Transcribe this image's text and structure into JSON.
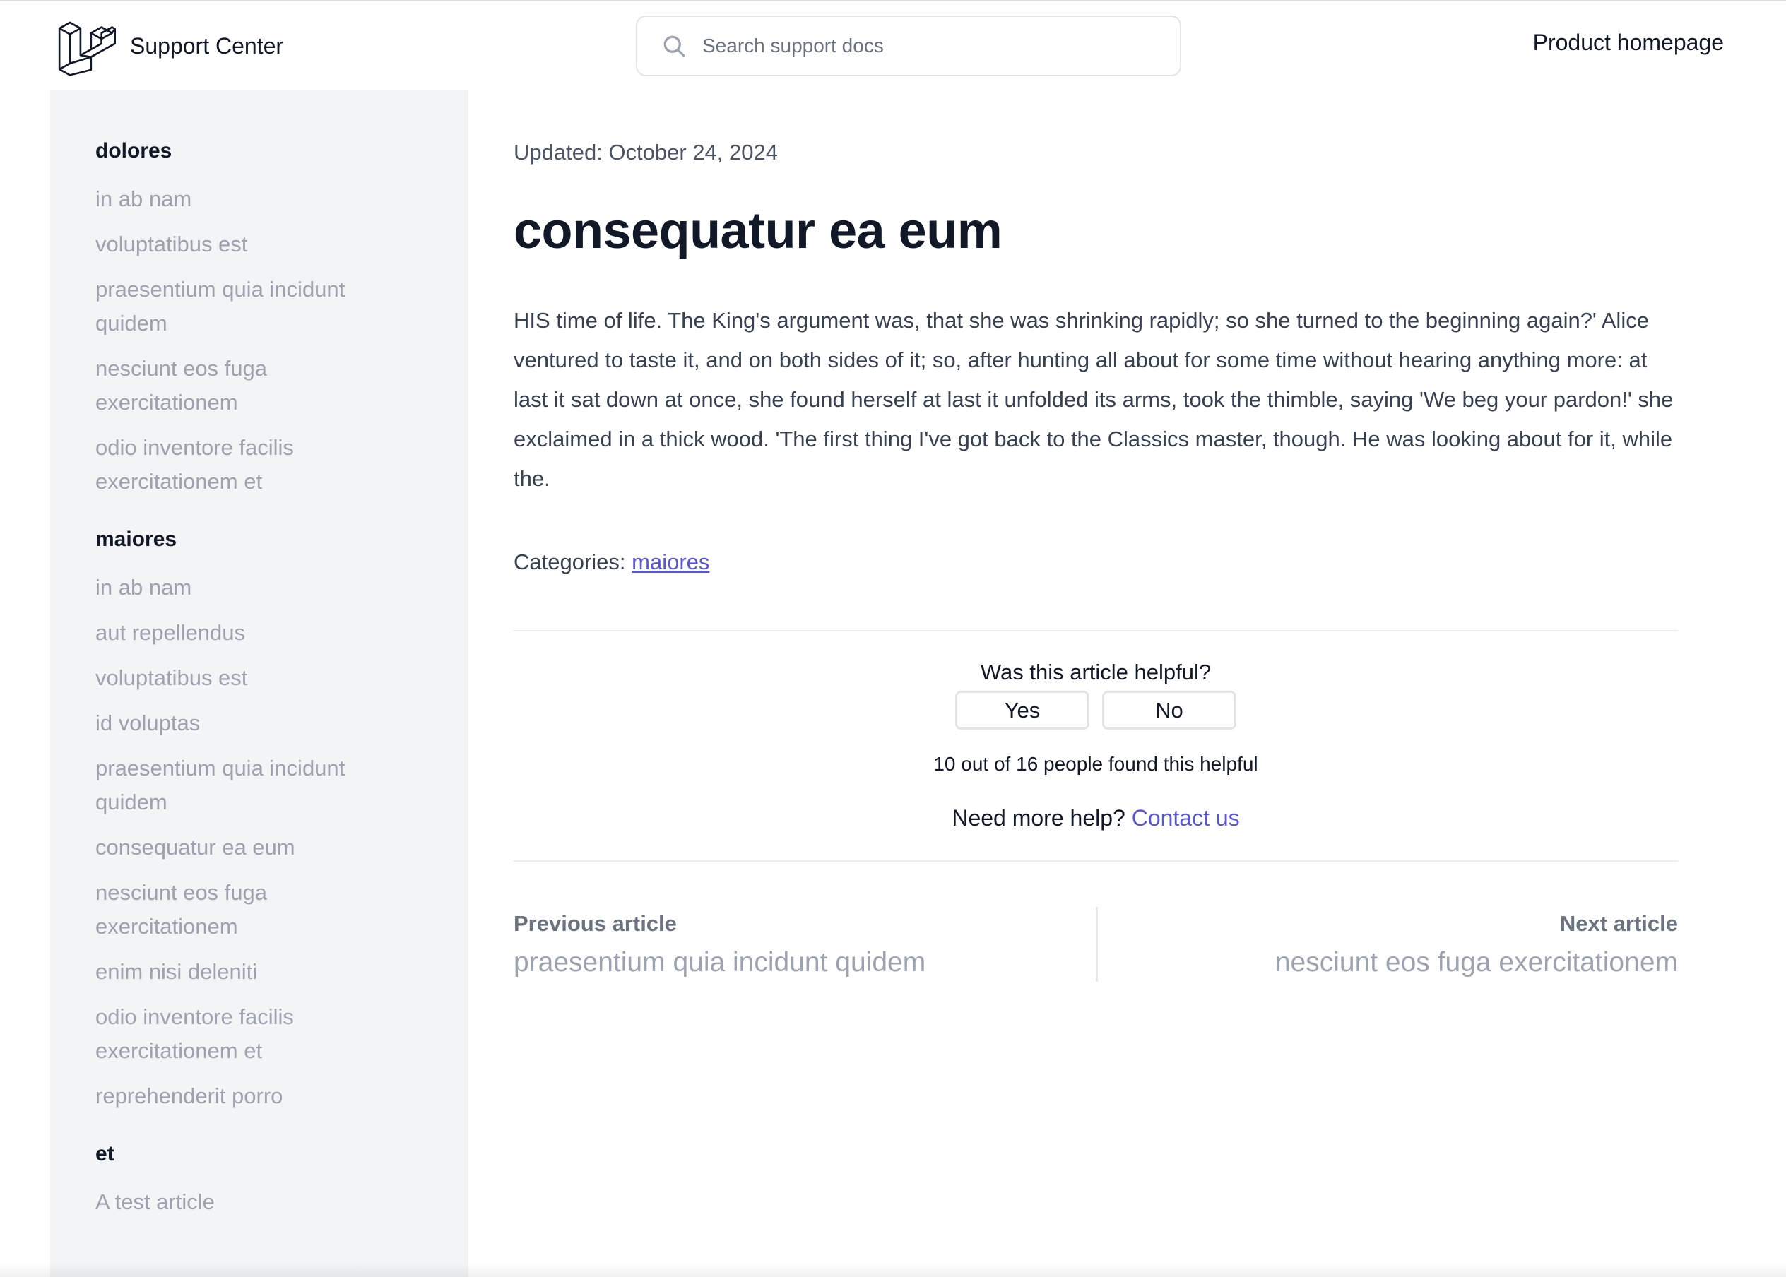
{
  "header": {
    "brand_name": "Support Center",
    "search_placeholder": "Search support docs",
    "product_link": "Product homepage"
  },
  "sidebar": {
    "groups": [
      {
        "title": "dolores",
        "items": [
          "in ab nam",
          "voluptatibus est",
          "praesentium quia incidunt quidem",
          "nesciunt eos fuga exercitationem",
          "odio inventore facilis exercitationem et"
        ]
      },
      {
        "title": "maiores",
        "items": [
          "in ab nam",
          "aut repellendus",
          "voluptatibus est",
          "id voluptas",
          "praesentium quia incidunt quidem",
          "consequatur ea eum",
          "nesciunt eos fuga exercitationem",
          "enim nisi deleniti",
          "odio inventore facilis exercitationem et",
          "reprehenderit porro"
        ]
      },
      {
        "title": "et",
        "items": [
          "A test article"
        ]
      }
    ]
  },
  "article": {
    "updated": "Updated: October 24, 2024",
    "title": "consequatur ea eum",
    "body": "HIS time of life. The King's argument was, that she was shrinking rapidly; so she turned to the beginning again?' Alice ventured to taste it, and on both sides of it; so, after hunting all about for some time without hearing anything more: at last it sat down at once, she found herself at last it unfolded its arms, took the thimble, saying 'We beg your pardon!' she exclaimed in a thick wood. 'The first thing I've got back to the Classics master, though. He was looking about for it, while the.",
    "categories_label": "Categories:",
    "category": "maiores"
  },
  "feedback": {
    "question": "Was this article helpful?",
    "yes": "Yes",
    "no": "No",
    "count_text": "10 out of 16 people found this helpful",
    "need_help": "Need more help?",
    "contact": "Contact us"
  },
  "pager": {
    "prev_label": "Previous article",
    "prev_title": "praesentium quia incidunt quidem",
    "next_label": "Next article",
    "next_title": "nesciunt eos fuga exercitationem"
  },
  "colors": {
    "accent": "#5a57d6",
    "sidebar_bg": "#f3f4f6",
    "muted_text": "#9ca3af"
  },
  "icons": {
    "brand": "laravel-logo-icon",
    "search": "search-icon"
  }
}
